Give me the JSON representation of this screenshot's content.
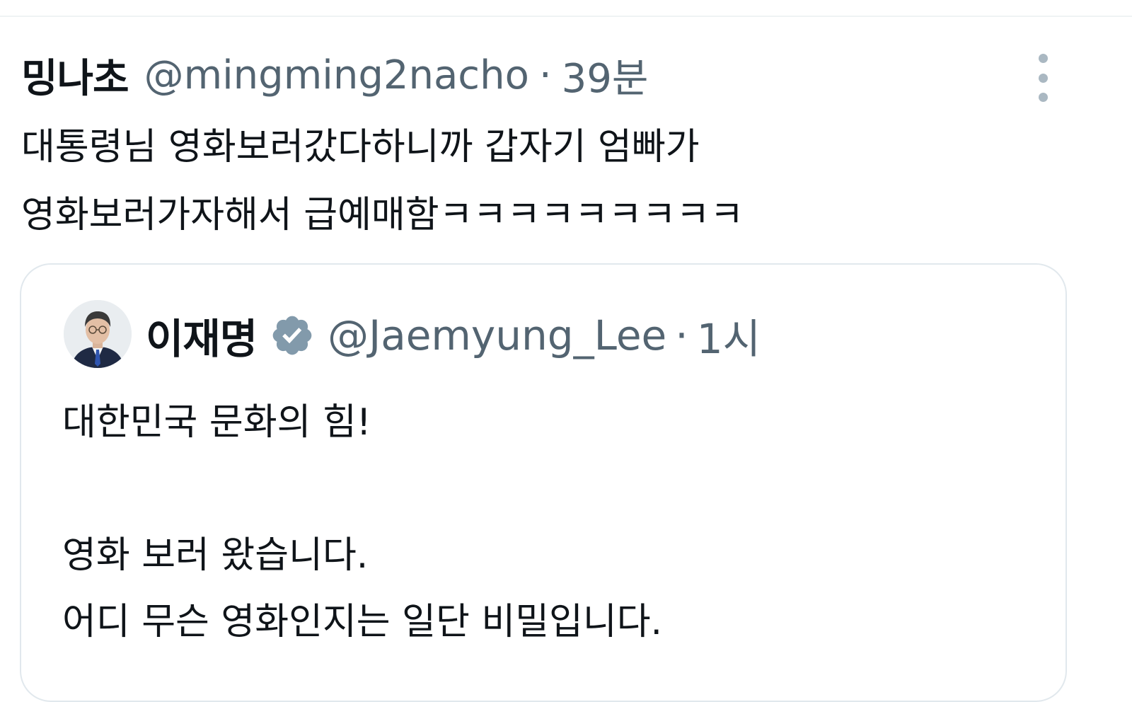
{
  "tweet": {
    "display_name": "밍나초",
    "handle": "@mingming2nacho",
    "separator": "·",
    "time": "39분",
    "text_lines": [
      "대통령님 영화보러갔다하니까 갑자기 엄빠가",
      "영화보러가자해서 급예매함ㅋㅋㅋㅋㅋㅋㅋㅋㅋ"
    ],
    "more_icon": "more-vertical-icon"
  },
  "quoted_tweet": {
    "display_name": "이재명",
    "verified_icon": "verified-badge-icon",
    "handle": "@Jaemyung_Lee",
    "separator": "·",
    "time": "1시",
    "text_lines": [
      "대한민국 문화의 힘!",
      "",
      "영화 보러 왔습니다.",
      "어디 무슨 영화인지는 일단 비밀입니다."
    ]
  },
  "colors": {
    "text_primary": "#0f1419",
    "text_secondary": "#536471",
    "border": "#e1e8ed",
    "verified_badge": "#829aab"
  }
}
